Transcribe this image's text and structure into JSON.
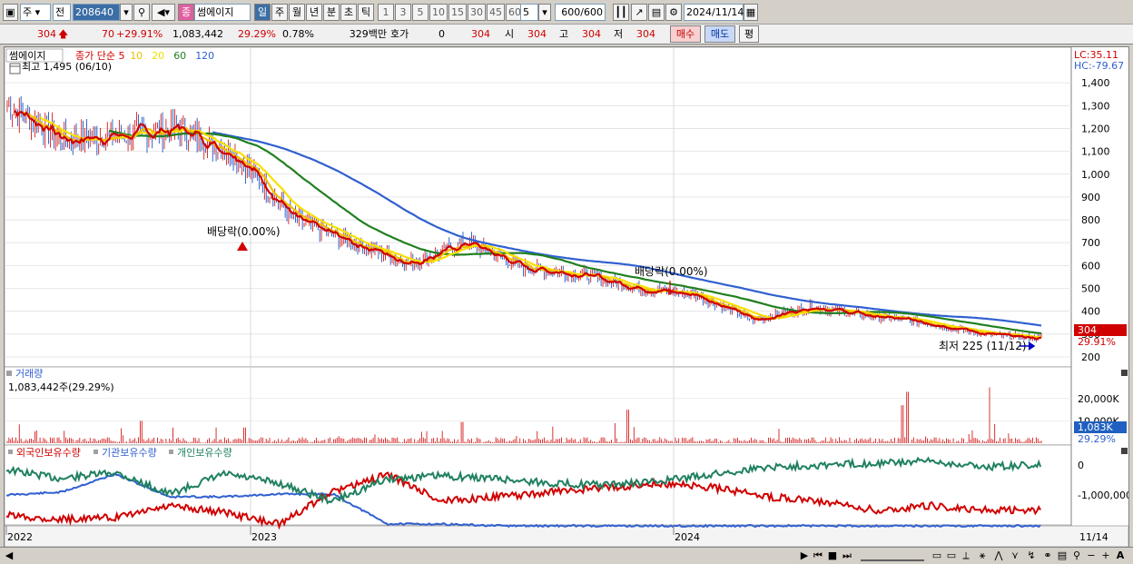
{
  "toolbar": {
    "market": "주",
    "prefix": "전",
    "code": "208640",
    "name": "썸에이지",
    "name_badge": "종",
    "periods": [
      "일",
      "주",
      "월",
      "년",
      "분",
      "초",
      "틱"
    ],
    "active_period": "일",
    "numbers": [
      "1",
      "3",
      "5",
      "10",
      "15",
      "30",
      "45",
      "60"
    ],
    "count_value": "5",
    "range": "600/600",
    "date": "2024/11/14"
  },
  "quote": {
    "price": "304",
    "change": "70",
    "change_pct": "+29.91%",
    "volume": "1,083,442",
    "volume_pct": "29.29%",
    "turnover": "0.78%",
    "amount": "329백만",
    "hoga_label": "호가",
    "hoga_value": "0",
    "hoga_price": "304",
    "open_label": "시",
    "open": "304",
    "high_label": "고",
    "high": "304",
    "low_label": "저",
    "low": "304",
    "buy_label": "매수",
    "sell_label": "매도",
    "avg_label": "평"
  },
  "price_panel": {
    "stock_label": "썸에이지",
    "legend": [
      {
        "text": "종가 단순 5",
        "color": "#d00000"
      },
      {
        "text": "10",
        "color": "#e8c000"
      },
      {
        "text": "20",
        "color": "#f0e000"
      },
      {
        "text": "60",
        "color": "#208020"
      },
      {
        "text": "120",
        "color": "#3060d0"
      }
    ],
    "high_note": "최고 1,495 (06/10)",
    "low_note": "최저 225 (11/12)",
    "lc": "LC:35.11",
    "hc": "HC:-79.67",
    "current_tag": "304",
    "current_pct": "29.91%",
    "annotations": [
      "배당락(0.00%)",
      "배당락(0.00%)"
    ]
  },
  "volume_panel": {
    "title": "거래량",
    "value": "1,083,442주(29.29%)",
    "current_tag": "1,083K",
    "current_pct": "29.29%"
  },
  "holding_panel": {
    "series": [
      {
        "name": "외국인보유수량",
        "color": "#d00000"
      },
      {
        "name": "기관보유수량",
        "color": "#3060d0"
      },
      {
        "name": "개인보유수량",
        "color": "#208060"
      }
    ]
  },
  "x_labels": [
    "2022",
    "2023",
    "2024"
  ],
  "x_end_label": "11/14",
  "chart_data": [
    {
      "type": "line",
      "title": "",
      "x": [
        "2022-01",
        "2022-03",
        "2022-05",
        "2022-06",
        "2022-08",
        "2022-10",
        "2022-12",
        "2023-01",
        "2023-03",
        "2023-05",
        "2023-07",
        "2023-09",
        "2023-11",
        "2024-01",
        "2024-03",
        "2024-05",
        "2024-07",
        "2024-09",
        "2024-11"
      ],
      "series": [
        {
          "name": "종가 단순 5",
          "values": [
            1300,
            1150,
            1170,
            1200,
            1080,
            800,
            700,
            610,
            700,
            590,
            560,
            500,
            470,
            360,
            420,
            380,
            350,
            300,
            280
          ]
        }
      ],
      "ylim": [
        180,
        1500
      ],
      "y_ticks": [
        200,
        300,
        400,
        500,
        600,
        700,
        800,
        900,
        1000,
        1100,
        1200,
        1300,
        1400
      ]
    },
    {
      "type": "bar",
      "title": "",
      "y_ticks_labels": [
        "20,000K",
        "10,000K"
      ],
      "ylim": [
        0,
        26000
      ]
    },
    {
      "type": "line",
      "title": "",
      "y_ticks_labels": [
        "0",
        "-1,000,000"
      ]
    }
  ]
}
